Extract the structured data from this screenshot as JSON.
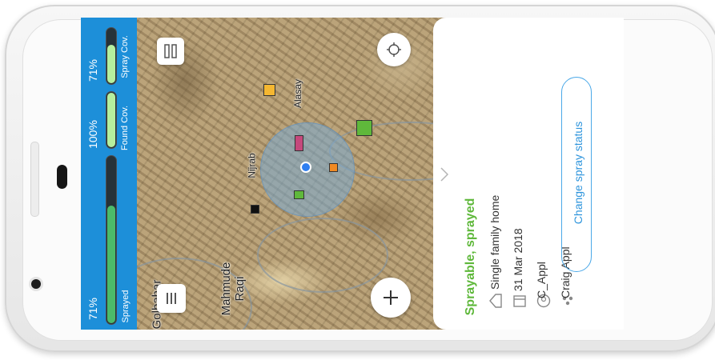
{
  "stats": {
    "sprayed": {
      "percent": "71%",
      "label": "Sprayed",
      "fraction": 0.71
    },
    "found_coverage": {
      "percent": "100%",
      "label": "Found Cov.",
      "fraction": 1.0
    },
    "spray_coverage": {
      "percent": "71%",
      "label": "Spray Cov.",
      "fraction": 0.71
    }
  },
  "map": {
    "labels": {
      "alasay": "Alasay",
      "nijrab": "Nijrab",
      "mahmude_raqi": "Mahmude\nRaqi",
      "golbahar": "Golbahar"
    },
    "marker_colors": {
      "yellow": "#f5b731",
      "green": "#5fb83b",
      "pink": "#c5487c",
      "orange": "#f08a24",
      "black": "#111111"
    }
  },
  "detail": {
    "status": "Sprayable, sprayed",
    "status_color": "#5fb83b",
    "type": "Single family home",
    "date": "31 Mar 2018",
    "user": "C_Appl",
    "owner": "Craig Appl",
    "action_label": "Change spray status",
    "action_color": "#2d94dc"
  }
}
